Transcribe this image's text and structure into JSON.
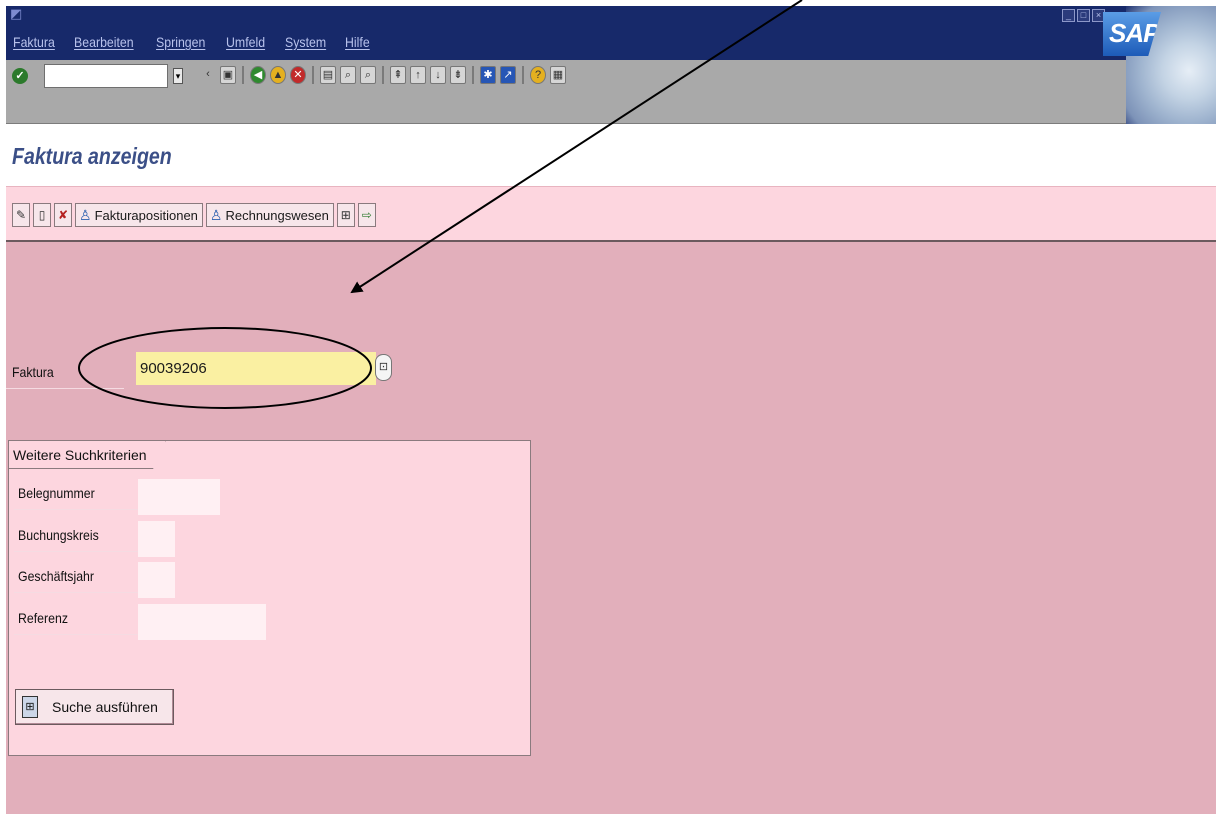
{
  "window": {
    "menu": [
      "Faktura",
      "Bearbeiten",
      "Springen",
      "Umfeld",
      "System",
      "Hilfe"
    ],
    "controls": [
      "_",
      "□",
      "×"
    ],
    "logo_text": "SAP"
  },
  "system_toolbar": {
    "command_value": "",
    "icons": [
      "confirm-icon",
      "back-icon",
      "save-icon",
      "back-icon",
      "exit-icon",
      "cancel-icon",
      "print-icon",
      "find-icon",
      "find-next-icon",
      "first-page-icon",
      "previous-page-icon",
      "next-page-icon",
      "last-page-icon",
      "create-session-icon",
      "shortcut-icon",
      "help-icon",
      "layout-menu-icon"
    ]
  },
  "screen": {
    "title": "Faktura anzeigen"
  },
  "app_toolbar": {
    "button_fakturapositionen": "Fakturapositionen",
    "button_rechnungswesen": "Rechnungswesen"
  },
  "form": {
    "faktura_label": "Faktura",
    "faktura_value": "90039206",
    "search_group_title": "Weitere Suchkriterien",
    "fields": {
      "belegnummer_label": "Belegnummer",
      "buchungskreis_label": "Buchungskreis",
      "geschaeftsjahr_label": "Geschäftsjahr",
      "referenz_label": "Referenz"
    },
    "search_button_label": "Suche ausführen"
  },
  "colors": {
    "menubar": "#17296a",
    "toolbar_pink": "#fdd6df",
    "main_bg": "#e2afbb",
    "input_highlight": "#faf0a2"
  }
}
